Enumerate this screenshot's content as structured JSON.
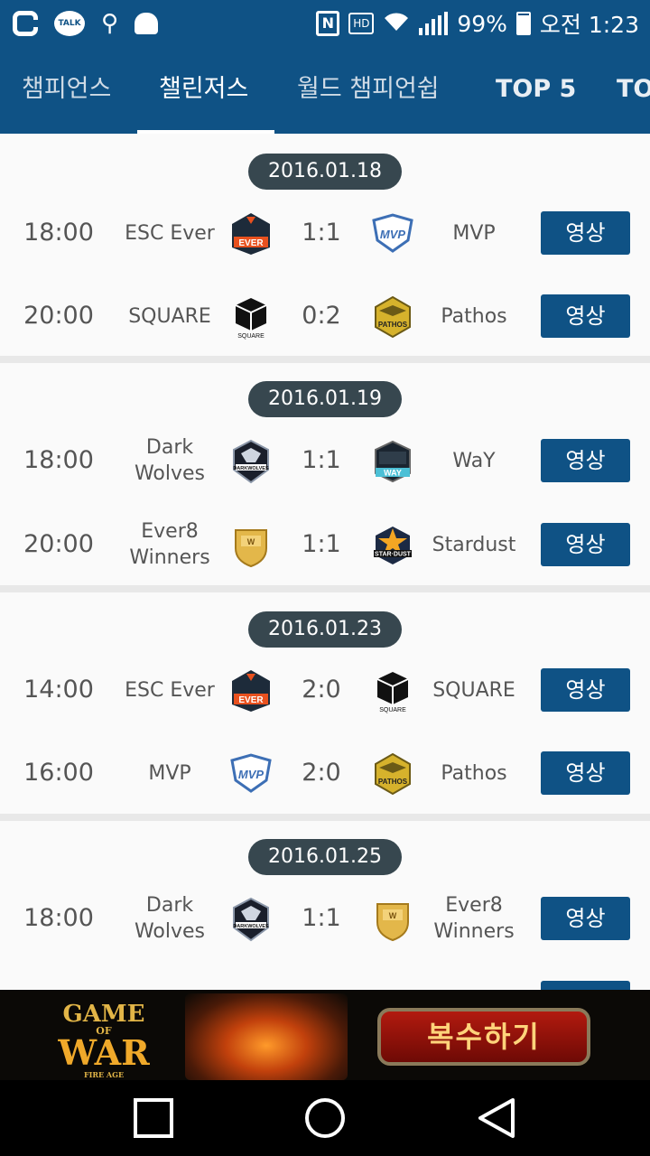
{
  "status_bar": {
    "battery": "99%",
    "time": "오전 1:23",
    "icons": [
      "o-app-icon",
      "kakaotalk-icon",
      "usb-icon",
      "android-debug-icon",
      "nfc-icon",
      "hd-voice-icon",
      "wifi-icon",
      "signal-icon",
      "battery-icon"
    ],
    "talk_label": "TALK",
    "hd_label": "HD",
    "nfc_label": "N"
  },
  "tabs": [
    {
      "label": "챔피언스"
    },
    {
      "label": "챌린저스"
    },
    {
      "label": "월드 챔피언쉽"
    },
    {
      "label": "TOP 5"
    },
    {
      "label": "TO"
    }
  ],
  "active_tab": 1,
  "video_label": "영상",
  "days": [
    {
      "date": "2016.01.18",
      "matches": [
        {
          "time": "18:00",
          "home": "ESC Ever",
          "score": "1:1",
          "away": "MVP"
        },
        {
          "time": "20:00",
          "home": "SQUARE",
          "score": "0:2",
          "away": "Pathos"
        }
      ]
    },
    {
      "date": "2016.01.19",
      "matches": [
        {
          "time": "18:00",
          "home": "Dark\nWolves",
          "score": "1:1",
          "away": "WaY"
        },
        {
          "time": "20:00",
          "home": "Ever8\nWinners",
          "score": "1:1",
          "away": "Stardust"
        }
      ]
    },
    {
      "date": "2016.01.23",
      "matches": [
        {
          "time": "14:00",
          "home": "ESC Ever",
          "score": "2:0",
          "away": "SQUARE"
        },
        {
          "time": "16:00",
          "home": "MVP",
          "score": "2:0",
          "away": "Pathos"
        }
      ]
    },
    {
      "date": "2016.01.25",
      "matches": [
        {
          "time": "18:00",
          "home": "Dark\nWolves",
          "score": "1:1",
          "away": "Ever8\nWinners"
        }
      ]
    }
  ],
  "logo_labels": {
    "ever": "EVER",
    "mvp": "MVP",
    "square": "SQUARE",
    "pathos": "PATHOS",
    "darkwolves": "DARKWOLVES",
    "way": "WAY",
    "stardust": "STAR·DUST",
    "ever8": "W"
  },
  "ad": {
    "logo_line1": "GAME",
    "logo_line2": "OF",
    "logo_line3": "WAR",
    "logo_sub": "FIRE AGE",
    "cta": "복수하기",
    "colors": {
      "cta_bg": "#8e1208",
      "cta_text": "#ffd37a"
    }
  },
  "colors": {
    "primary": "#0f5285",
    "date_pill": "#37474f"
  }
}
